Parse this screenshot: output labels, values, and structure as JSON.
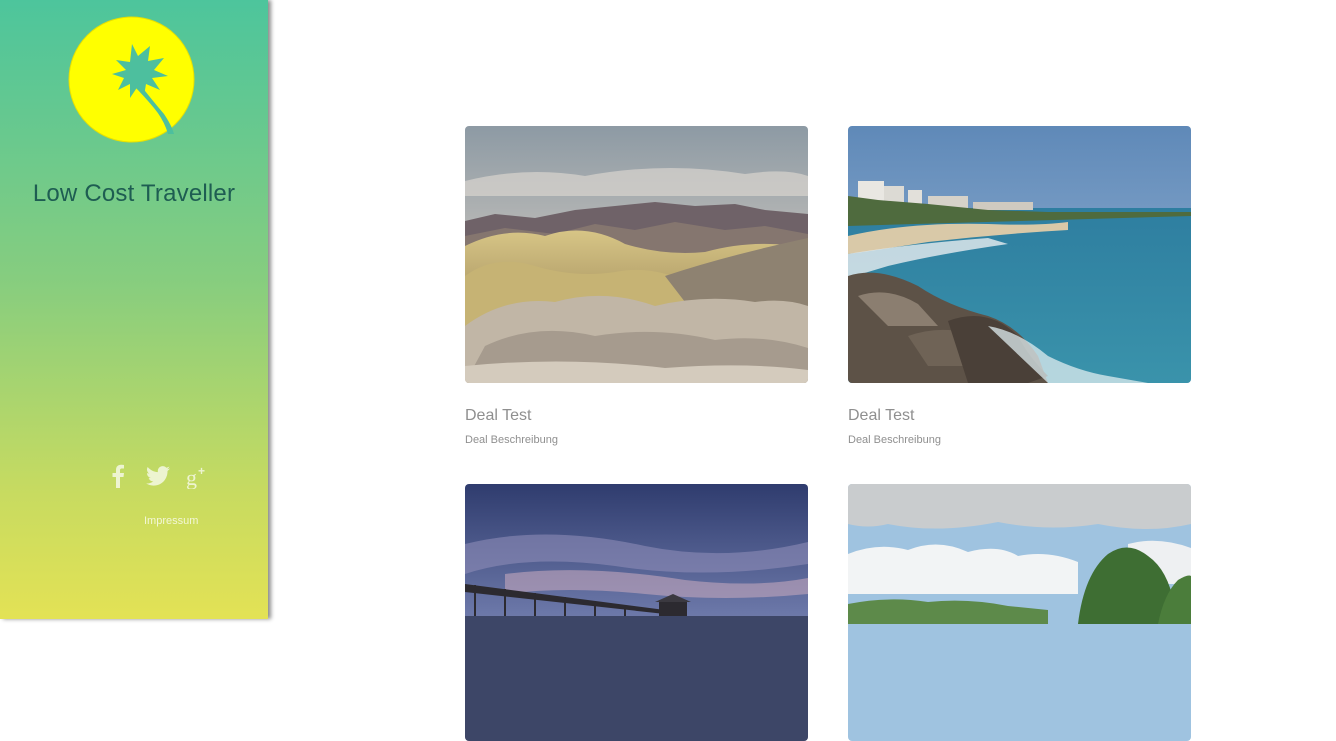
{
  "sidebar": {
    "site_title": "Low Cost Traveller",
    "logo_icon": "palm-tree-sun-logo",
    "social": [
      {
        "name": "facebook-icon"
      },
      {
        "name": "twitter-icon"
      },
      {
        "name": "google-plus-icon"
      }
    ],
    "impressum_label": "Impressum"
  },
  "deals": [
    {
      "title": "Deal Test",
      "description": "Deal Beschreibung",
      "image": "desert-badlands-photo"
    },
    {
      "title": "Deal Test",
      "description": "Deal Beschreibung",
      "image": "beach-coast-photo"
    },
    {
      "title": "",
      "description": "",
      "image": "pier-sunset-photo"
    },
    {
      "title": "",
      "description": "",
      "image": "trees-sky-photo"
    }
  ],
  "colors": {
    "sidebar_top": "#4dc59c",
    "sidebar_bottom": "#e3e255",
    "logo_circle": "#ffff00",
    "title_color": "#1e5d52",
    "card_text": "#8f8f8f"
  }
}
